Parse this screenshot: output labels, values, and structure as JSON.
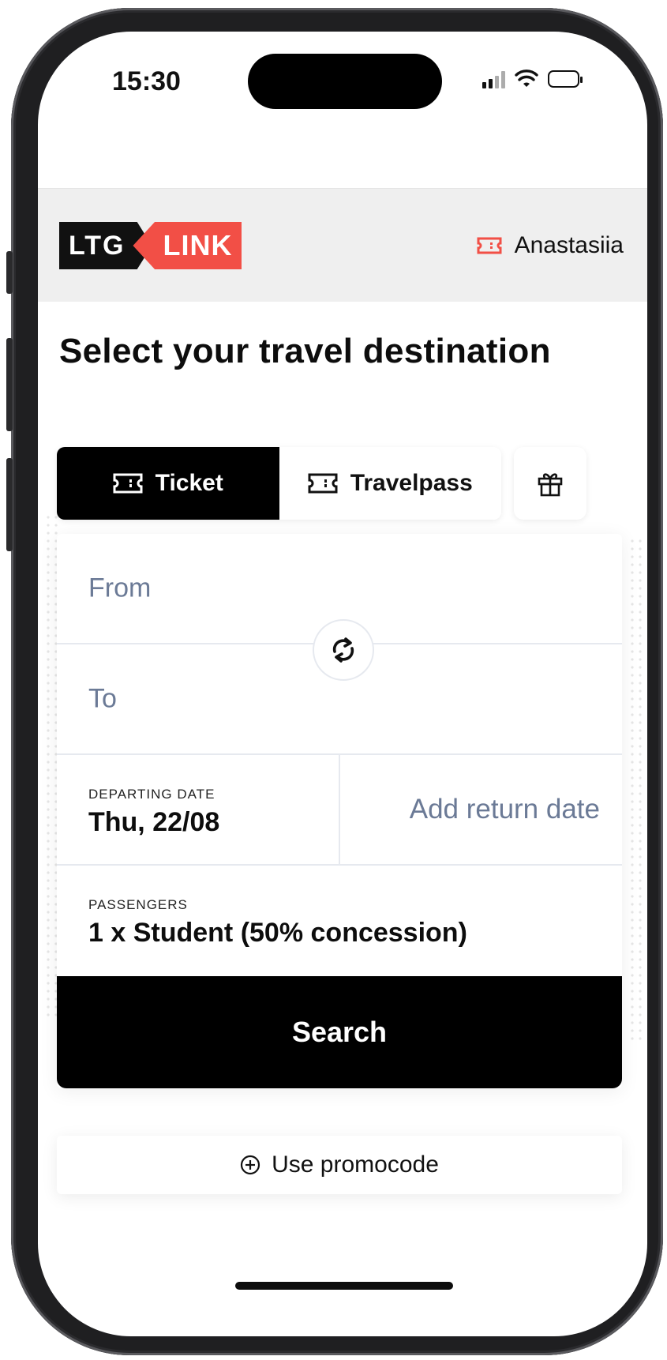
{
  "status_bar": {
    "time": "15:30"
  },
  "header": {
    "logo_left": "LTG",
    "logo_right": "LINK",
    "user_name": "Anastasiia"
  },
  "page": {
    "title": "Select your travel destination"
  },
  "tabs": [
    {
      "label": "Ticket",
      "active": true
    },
    {
      "label": "Travelpass",
      "active": false
    }
  ],
  "form": {
    "from_placeholder": "From",
    "to_placeholder": "To",
    "departing_label": "DEPARTING DATE",
    "departing_value": "Thu, 22/08",
    "return_placeholder": "Add return date",
    "passengers_label": "PASSENGERS",
    "passengers_value": "1 x Student (50% concession)",
    "search_label": "Search"
  },
  "promo": {
    "label": "Use promocode"
  },
  "colors": {
    "brand_red": "#f24f46",
    "placeholder": "#6b7a96",
    "primary": "#000000"
  },
  "icons": [
    "ticket-icon",
    "gift-icon",
    "swap-icon",
    "plus-circle-icon",
    "wifi-icon",
    "battery-icon",
    "signal-icon"
  ]
}
